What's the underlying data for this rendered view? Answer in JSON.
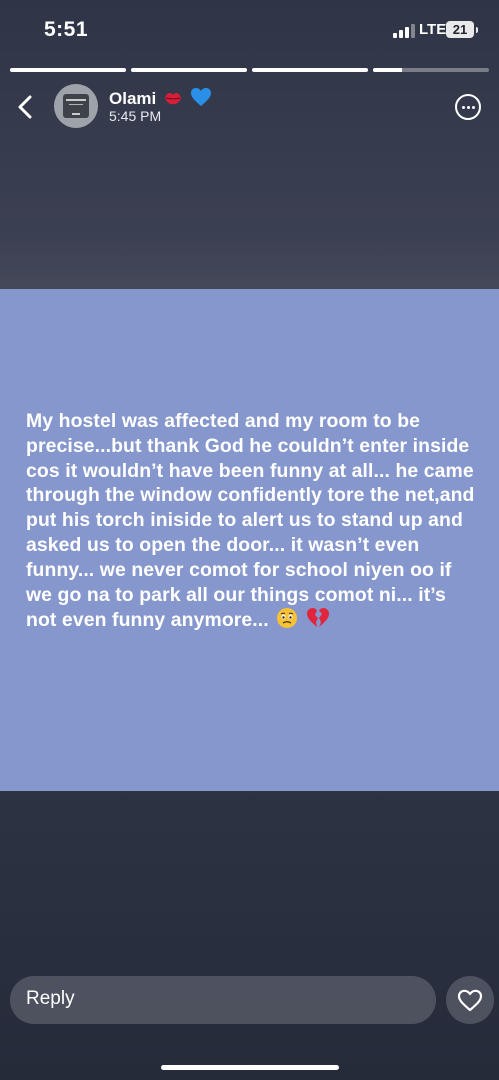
{
  "status_bar": {
    "time": "5:51",
    "network": "LTE",
    "battery_level": "21"
  },
  "story_progress": {
    "segments_total": 4,
    "current_segment": 4,
    "current_segment_progress": 0.25
  },
  "header": {
    "user_name": "Olami",
    "name_emojis": [
      "kiss-mark-emoji",
      "blue-heart-emoji"
    ],
    "timestamp": "5:45 PM",
    "icons": {
      "back": "chevron-left-icon",
      "more": "ellipsis-circle-icon"
    }
  },
  "story": {
    "background_color": "#8697cd",
    "text": "My hostel was affected and my room to be precise...but thank God he couldn’t enter inside cos it wouldn’t have been funny at all... he came through the window confidently tore the net,and put his torch iniside to alert us to stand up and asked us to open the door... it wasn’t even funny... we never comot for school niyen oo if we go na to park all our things comot ni... it’s not even funny anymore...",
    "trailing_emojis": [
      "face-holding-back-tears-emoji",
      "broken-heart-emoji"
    ]
  },
  "footer": {
    "reply_placeholder": "Reply",
    "like_icon": "heart-icon"
  }
}
